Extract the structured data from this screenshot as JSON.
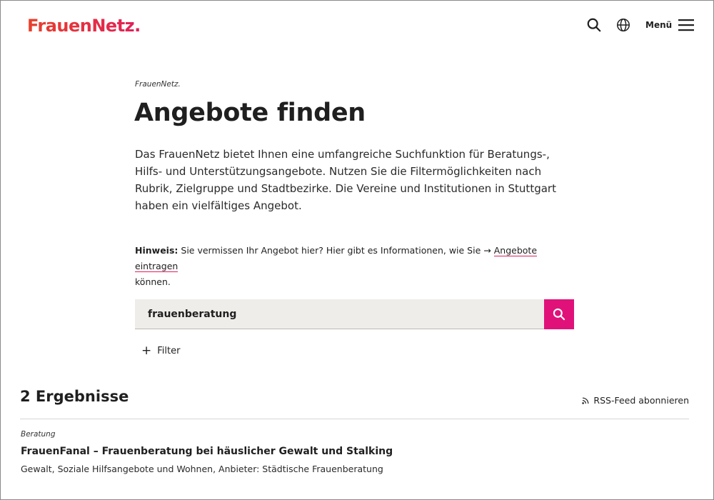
{
  "header": {
    "logo": "FrauenNetz.",
    "menu_label": "Menü",
    "icons": [
      "search-icon",
      "globe-icon",
      "hamburger-icon"
    ]
  },
  "main": {
    "breadcrumb": "FrauenNetz.",
    "title": "Angebote finden",
    "intro": "Das FrauenNetz bietet Ihnen eine umfangreiche Suchfunktion für Beratungs-, Hilfs- und Unterstützungsangebote. Nutzen Sie die Filtermöglichkeiten nach Rubrik, Zielgruppe und Stadtbezirke. Die Vereine und Institutionen in Stuttgart haben ein vielfältiges Angebot.",
    "hint_label": "Hinweis:",
    "hint_text": "Sie vermissen Ihr Angebot hier? Hier gibt es Informationen, wie Sie",
    "hint_arrow": "→",
    "hint_link": "Angebote eintragen",
    "hint_suffix": "können."
  },
  "search": {
    "value": "frauenberatung",
    "button_color": "#e0127a"
  },
  "filter": {
    "icon": "+",
    "label": "Filter"
  },
  "results": {
    "title": "2 Ergebnisse",
    "rss_label": "RSS-Feed abonnieren",
    "items": [
      {
        "category": "Beratung",
        "title": "FrauenFanal – Frauenberatung bei häuslicher Gewalt und Stalking",
        "meta": "Gewalt, Soziale Hilfsangebote und Wohnen, Anbieter: Städtische Frauenberatung"
      }
    ]
  },
  "colors": {
    "brand_start": "#e8402a",
    "brand_end": "#e0205a",
    "accent": "#e0127a",
    "search_bg": "#efedea"
  }
}
